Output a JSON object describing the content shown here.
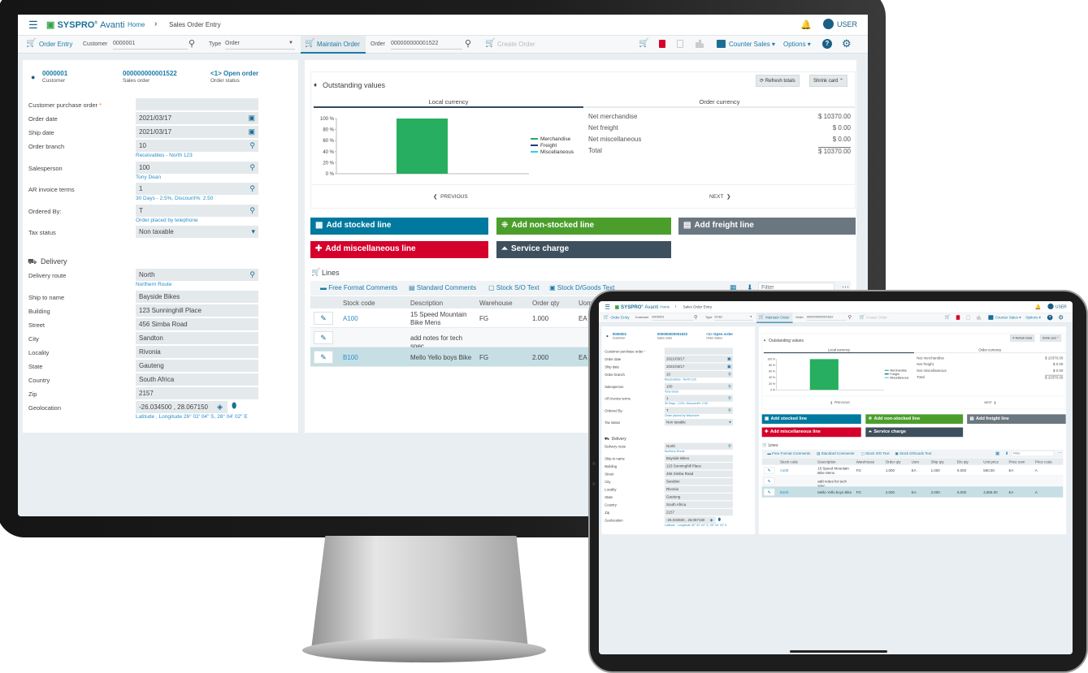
{
  "app": {
    "brand": "SYSPRO",
    "product": "Avanti",
    "breadcrumb_home": "Home",
    "breadcrumb_current": "Sales Order Entry",
    "user": "USER"
  },
  "toolbar": {
    "order_entry": "Order Entry",
    "customer_label": "Customer",
    "customer_value": "0000001",
    "type_label": "Type",
    "type_value": "Order",
    "maintain_order": "Maintain Order",
    "order_label": "Order",
    "order_value": "000000000001522",
    "create_order": "Create Order",
    "counter_sales": "Counter Sales",
    "options": "Options"
  },
  "summary": {
    "customer": {
      "value": "0000001",
      "label": "Customer"
    },
    "sales_order": {
      "value": "000000000001522",
      "label": "Sales order"
    },
    "status": {
      "value": "<1> Open order",
      "label": "Order status"
    }
  },
  "form": {
    "fields": [
      {
        "label": "Customer purchase order",
        "value": "",
        "kind": "text",
        "required": "*"
      },
      {
        "label": "Order date",
        "value": "2021/03/17",
        "kind": "date"
      },
      {
        "label": "Ship date",
        "value": "2021/03/17",
        "kind": "date"
      },
      {
        "label": "Order branch",
        "value": "10",
        "kind": "lookup",
        "help": "Receivables - North 123"
      },
      {
        "label": "Salesperson",
        "value": "100",
        "kind": "lookup",
        "help": "Tony Dean"
      },
      {
        "label": "AR invoice terms",
        "value": "1",
        "kind": "lookup",
        "help": "30 Days - 2.5%, Discount%: 2.50"
      },
      {
        "label": "Ordered By:",
        "value": "T",
        "kind": "lookup",
        "help": "Order placed by telephone"
      },
      {
        "label": "Tax status",
        "value": "Non taxable",
        "kind": "select"
      }
    ],
    "delivery_title": "Delivery",
    "delivery_fields": [
      {
        "label": "Delivery route",
        "value": "North",
        "kind": "lookup",
        "help": "Northern Route"
      },
      {
        "label": "Ship to name",
        "value": "Bayside Bikes",
        "kind": "text"
      },
      {
        "label": "Building",
        "value": "123 Sunninghill Place",
        "kind": "text"
      },
      {
        "label": "Street",
        "value": "456 Simba Road",
        "kind": "text"
      },
      {
        "label": "City",
        "value": "Sandton",
        "kind": "text"
      },
      {
        "label": "Locality",
        "value": "Rivonia",
        "kind": "text"
      },
      {
        "label": "State",
        "value": "Gauteng",
        "kind": "text"
      },
      {
        "label": "Country",
        "value": "South Africa",
        "kind": "text"
      },
      {
        "label": "Zip",
        "value": "2157",
        "kind": "text"
      },
      {
        "label": "Geolocation",
        "value": "-26.034500 , 28.067150",
        "kind": "geo",
        "help": "Latitude , Longitude 26° 02' 04\" S, 28° 04' 02\" E"
      }
    ]
  },
  "outstanding": {
    "title": "Outstanding values",
    "refresh": "Refresh totals",
    "shrink": "Shrink card",
    "tabs": [
      "Local currency",
      "Order currency"
    ],
    "active_tab": "Local currency",
    "totals": [
      {
        "label": "Net merchandise",
        "value": "$ 10370.00"
      },
      {
        "label": "Net freight",
        "value": "$ 0.00"
      },
      {
        "label": "Net miscellaneous",
        "value": "$ 0.00"
      },
      {
        "label": "Total",
        "value": "$ 10370.00"
      }
    ],
    "previous": "PREVIOUS",
    "next": "NEXT"
  },
  "chart_data": {
    "type": "bar",
    "stacked": true,
    "series": [
      {
        "name": "Merchandise",
        "values": [
          100
        ],
        "color": "#27ae60"
      },
      {
        "name": "Freight",
        "values": [
          0
        ],
        "color": "#1f3d7a"
      },
      {
        "name": "Miscellaneous",
        "values": [
          0
        ],
        "color": "#22d3ee"
      }
    ],
    "yticks": [
      "100 %",
      "80 %",
      "60 %",
      "40 %",
      "20 %",
      "0 %"
    ],
    "ylim": [
      0,
      100
    ],
    "legend": "right",
    "grid": false
  },
  "actions": [
    {
      "label": "Add stocked line",
      "color": "#00799e",
      "icon": "stocked-line-icon"
    },
    {
      "label": "Add non-stocked line",
      "color": "#4c9e2c",
      "icon": "non-stocked-line-icon"
    },
    {
      "label": "Add freight line",
      "color": "#6b7780",
      "icon": "freight-icon"
    },
    {
      "label": "Add miscellaneous line",
      "color": "#d4002b",
      "icon": "miscellaneous-icon"
    },
    {
      "label": "Service charge",
      "color": "#3e505e",
      "icon": "service-bell-icon"
    }
  ],
  "lines": {
    "title": "Lines",
    "tools": [
      "Free Format Comments",
      "Standard Comments",
      "Stock S/O Text",
      "Stock D/Goods Text"
    ],
    "filter_placeholder": "Filter",
    "columns": [
      "Stock code",
      "Description",
      "Warehouse",
      "Order qty",
      "Uom",
      "Ship qty",
      "B/o qty",
      "Unit price",
      "Price uom",
      "Price code"
    ],
    "rows": [
      {
        "cells": [
          "A100",
          "15 Speed Mountain Bike Mens",
          "FG",
          "1.000",
          "EA",
          "1.000",
          "0.000",
          "560.00",
          "EA",
          "A"
        ],
        "selected": false
      },
      {
        "cells": [
          "",
          "add notes for tech spec",
          "",
          "",
          "",
          "",
          "",
          "",
          "",
          ""
        ],
        "selected": false
      },
      {
        "cells": [
          "B100",
          "Mello Yello boys Bike",
          "FG",
          "2.000",
          "EA",
          "2.000",
          "0.000",
          "4,905.00",
          "EA",
          "A"
        ],
        "selected": true
      }
    ]
  },
  "colors": {
    "accent": "#1b7aa8",
    "selected_row": "#c5dfe4",
    "field_bg": "#e4e9ec"
  }
}
